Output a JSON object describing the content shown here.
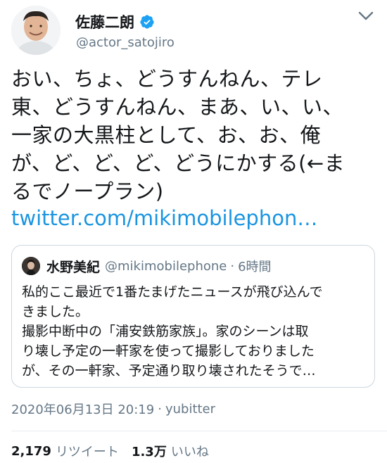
{
  "author": {
    "display_name": "佐藤二朗",
    "handle": "@actor_satojiro",
    "verified": true
  },
  "tweet": {
    "lines": [
      "おい、ちょ、どうすんねん、テレ",
      "東、どうすんねん、まあ、い、い、",
      "一家の大黒柱として、お、お、俺",
      "が、ど、ど、ど、どうにかする(←ま",
      "るでノープラン)"
    ],
    "link": "twitter.com/mikimobilephon…"
  },
  "quote": {
    "display_name": "水野美紀",
    "handle": "@mikimobilephone",
    "separator": "·",
    "time": "6時間",
    "lines": [
      "私的ここ最近で1番たまげたニュースが飛び込んで",
      "きました。",
      "撮影中断中の「浦安鉄筋家族」。家のシーンは取",
      "り壊し予定の一軒家を使って撮影しておりました",
      "が、その一軒家、予定通り取り壊されたそうで…"
    ]
  },
  "meta": {
    "timestamp": "2020年06月13日 20:19",
    "separator": "·",
    "source": "yubitter"
  },
  "stats": {
    "retweets": "2,179",
    "retweets_label": "リツイート",
    "likes": "1.3万",
    "likes_label": "いいね"
  },
  "colors": {
    "link": "#1b95e0",
    "verified": "#1da1f2",
    "secondary": "#657786",
    "border": "#ccd6dd"
  },
  "icons": {
    "verified": "verified-badge-icon",
    "caret": "chevron-down-icon"
  }
}
